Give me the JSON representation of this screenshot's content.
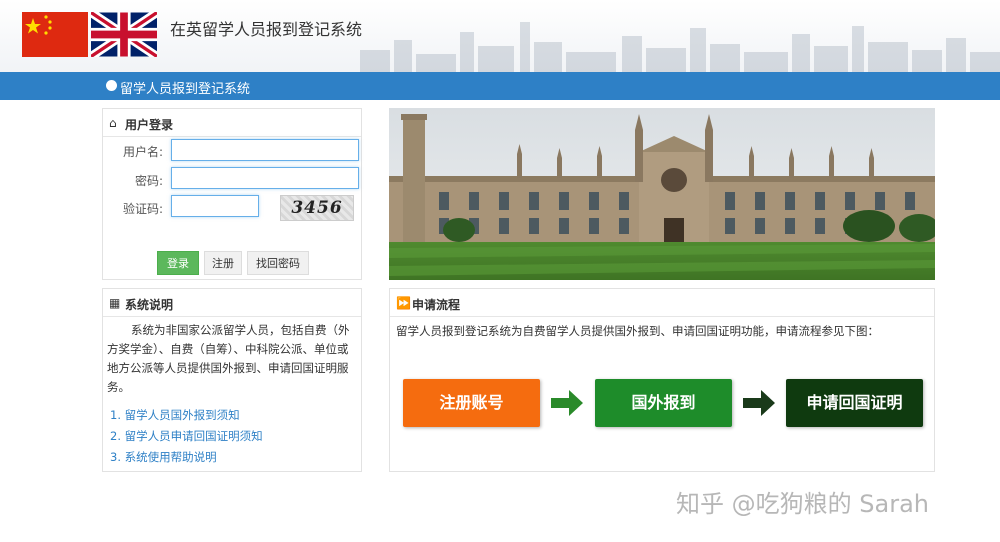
{
  "header": {
    "title": "在英留学人员报到登记系统"
  },
  "navbar": {
    "title": "留学人员报到登记系统"
  },
  "login": {
    "title": "用户登录",
    "username_label": "用户名:",
    "password_label": "密码:",
    "captcha_label": "验证码:",
    "username_value": "",
    "password_value": "",
    "captcha_value": "",
    "captcha_image_text": "3456",
    "login_button": "登录",
    "register_button": "注册",
    "forgot_button": "找回密码"
  },
  "system_info": {
    "title": "系统说明",
    "description": "系统为非国家公派留学人员，包括自费（外方奖学金）、自费（自筹）、中科院公派、单位或地方公派等人员提供国外报到、申请回国证明服务。",
    "links": [
      "1. 留学人员国外报到须知",
      "2. 留学人员申请回国证明须知",
      "3. 系统使用帮助说明"
    ]
  },
  "process": {
    "title": "申请流程",
    "description": "留学人员报到登记系统为自费留学人员提供国外报到、申请回国证明功能，申请流程参见下图：",
    "steps": [
      "注册账号",
      "国外报到",
      "申请回国证明"
    ]
  },
  "watermark": "知乎 @吃狗粮的 Sarah",
  "colors": {
    "nav_blue": "#2e80c6",
    "login_green": "#5cb85c",
    "step_orange": "#f56c0f",
    "step_green": "#1e8c2a",
    "step_dark_green": "#0f3a0f",
    "arrow_green": "#2a8a2a"
  }
}
